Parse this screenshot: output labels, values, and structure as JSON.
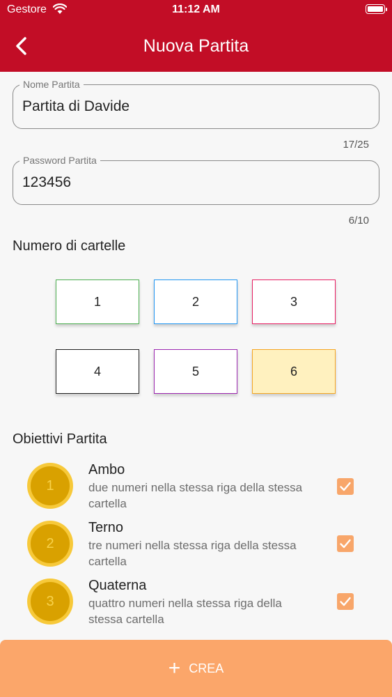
{
  "status": {
    "carrier": "Gestore",
    "time": "11:12 AM"
  },
  "header": {
    "title": "Nuova Partita"
  },
  "form": {
    "name_label": "Nome Partita",
    "name_value": "Partita di Davide",
    "name_counter": "17/25",
    "password_label": "Password Partita",
    "password_value": "123456",
    "password_counter": "6/10"
  },
  "cards": {
    "heading": "Numero di cartelle",
    "options": [
      "1",
      "2",
      "3",
      "4",
      "5",
      "6"
    ],
    "colors": [
      "#4caf50",
      "#2196f3",
      "#e91e63",
      "#212121",
      "#9c27b0",
      "#f5a623"
    ],
    "selected": "6"
  },
  "objectives": {
    "heading": "Obiettivi Partita",
    "items": [
      {
        "number": "1",
        "title": "Ambo",
        "desc": "due numeri nella stessa riga della stessa cartella",
        "checked": true
      },
      {
        "number": "2",
        "title": "Terno",
        "desc": "tre numeri nella stessa riga della stessa cartella",
        "checked": true
      },
      {
        "number": "3",
        "title": "Quaterna",
        "desc": "quattro numeri nella stessa riga della stessa cartella",
        "checked": true
      }
    ]
  },
  "action": {
    "label": "CREA"
  },
  "theme": {
    "primary": "#c20d26",
    "accent": "#fba66a",
    "coin": "#d9a100"
  }
}
